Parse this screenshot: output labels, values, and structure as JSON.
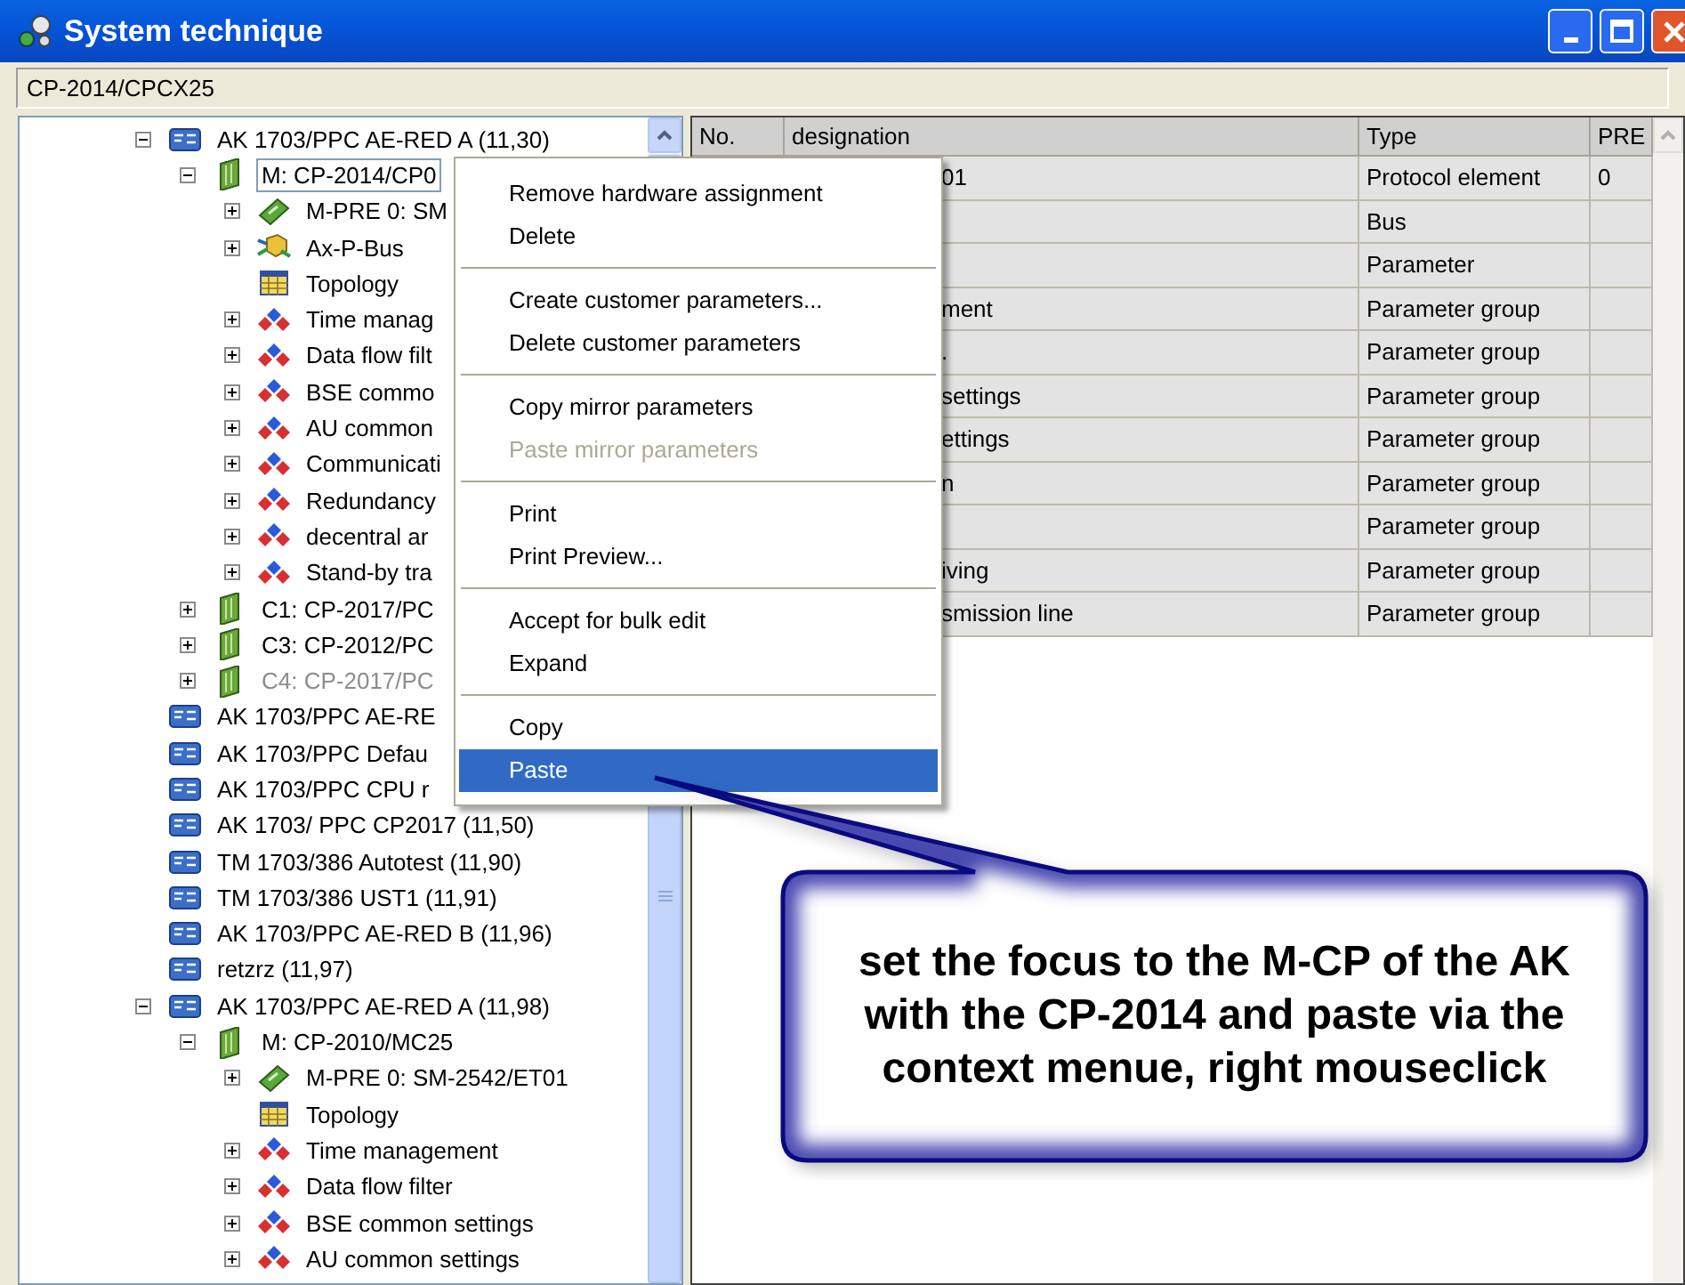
{
  "window": {
    "title": "System technique"
  },
  "path": "CP-2014/CPCX25",
  "tree": [
    {
      "label": "AK 1703/PPC AE-RED A (11,30)",
      "kind": "station",
      "expanded": true,
      "focused": false,
      "disabled": false,
      "children": [
        {
          "label": "M: CP-2014/CP0",
          "kind": "cpu",
          "expanded": true,
          "focused": true,
          "disabled": false,
          "children": [
            {
              "label": "M-PRE 0: SM",
              "kind": "chip",
              "expanded": false,
              "focused": false,
              "disabled": false
            },
            {
              "label": "Ax-P-Bus",
              "kind": "bus",
              "expanded": false,
              "focused": false,
              "disabled": false
            },
            {
              "label": "Topology",
              "kind": "topology",
              "focused": false,
              "disabled": false
            },
            {
              "label": "Time manag",
              "kind": "params",
              "expanded": false,
              "focused": false,
              "disabled": false
            },
            {
              "label": "Data flow filt",
              "kind": "params",
              "expanded": false,
              "focused": false,
              "disabled": false
            },
            {
              "label": "BSE commo",
              "kind": "params",
              "expanded": false,
              "focused": false,
              "disabled": false
            },
            {
              "label": "AU common",
              "kind": "params",
              "expanded": false,
              "focused": false,
              "disabled": false
            },
            {
              "label": "Communicati",
              "kind": "params",
              "expanded": false,
              "focused": false,
              "disabled": false
            },
            {
              "label": "Redundancy",
              "kind": "params",
              "expanded": false,
              "focused": false,
              "disabled": false
            },
            {
              "label": "decentral ar",
              "kind": "params",
              "expanded": false,
              "focused": false,
              "disabled": false
            },
            {
              "label": "Stand-by tra",
              "kind": "params",
              "expanded": false,
              "focused": false,
              "disabled": false
            }
          ]
        },
        {
          "label": "C1: CP-2017/PC",
          "kind": "cpu",
          "expanded": false,
          "focused": false,
          "disabled": false
        },
        {
          "label": "C3: CP-2012/PC",
          "kind": "cpu",
          "expanded": false,
          "focused": false,
          "disabled": false
        },
        {
          "label": "C4: CP-2017/PC",
          "kind": "cpu",
          "expanded": false,
          "focused": false,
          "disabled": true
        }
      ]
    },
    {
      "label": "AK 1703/PPC AE-RE",
      "kind": "station",
      "focused": false,
      "disabled": false
    },
    {
      "label": "AK 1703/PPC Defau",
      "kind": "station",
      "focused": false,
      "disabled": false
    },
    {
      "label": "AK 1703/PPC CPU r",
      "kind": "station",
      "focused": false,
      "disabled": false
    },
    {
      "label": "AK 1703/ PPC CP2017 (11,50)",
      "kind": "station",
      "focused": false,
      "disabled": false
    },
    {
      "label": "TM 1703/386 Autotest (11,90)",
      "kind": "station",
      "focused": false,
      "disabled": false
    },
    {
      "label": "TM 1703/386 UST1 (11,91)",
      "kind": "station",
      "focused": false,
      "disabled": false
    },
    {
      "label": "AK 1703/PPC AE-RED B (11,96)",
      "kind": "station",
      "focused": false,
      "disabled": false
    },
    {
      "label": "retzrz (11,97)",
      "kind": "station",
      "focused": false,
      "disabled": false
    },
    {
      "label": "AK 1703/PPC AE-RED A (11,98)",
      "kind": "station",
      "expanded": true,
      "focused": false,
      "disabled": false,
      "children": [
        {
          "label": "M: CP-2010/MC25",
          "kind": "cpu",
          "expanded": true,
          "focused": false,
          "disabled": false,
          "children": [
            {
              "label": "M-PRE 0: SM-2542/ET01",
              "kind": "chip",
              "expanded": false,
              "focused": false,
              "disabled": false
            },
            {
              "label": "Topology",
              "kind": "topology",
              "focused": false,
              "disabled": false
            },
            {
              "label": "Time management",
              "kind": "params",
              "expanded": false,
              "focused": false,
              "disabled": false
            },
            {
              "label": "Data flow filter",
              "kind": "params",
              "expanded": false,
              "focused": false,
              "disabled": false
            },
            {
              "label": "BSE common settings",
              "kind": "params",
              "expanded": false,
              "focused": false,
              "disabled": false
            },
            {
              "label": "AU common settings",
              "kind": "params",
              "expanded": false,
              "focused": false,
              "disabled": false
            }
          ]
        }
      ]
    }
  ],
  "table": {
    "columns": [
      "No.",
      "designation",
      "Type",
      "PRE"
    ],
    "rows": [
      {
        "designation": "01",
        "type": "Protocol element",
        "pre": "0"
      },
      {
        "type": "Bus"
      },
      {
        "type": "Parameter"
      },
      {
        "designation": "ment",
        "type": "Parameter group"
      },
      {
        "designation": ".",
        "type": "Parameter group"
      },
      {
        "designation": "settings",
        "type": "Parameter group"
      },
      {
        "designation": "ettings",
        "type": "Parameter group"
      },
      {
        "designation": "n",
        "type": "Parameter group"
      },
      {
        "type": "Parameter group"
      },
      {
        "designation": "iving",
        "type": "Parameter group"
      },
      {
        "designation": "smission line",
        "type": "Parameter group"
      }
    ]
  },
  "context_menu": [
    [
      {
        "label": "Remove hardware assignment",
        "disabled": false,
        "selected": false
      },
      {
        "label": "Delete",
        "disabled": false,
        "selected": false
      }
    ],
    [
      {
        "label": "Create customer parameters...",
        "disabled": false,
        "selected": false
      },
      {
        "label": "Delete customer parameters",
        "disabled": false,
        "selected": false
      }
    ],
    [
      {
        "label": "Copy mirror parameters",
        "disabled": false,
        "selected": false
      },
      {
        "label": "Paste mirror parameters",
        "disabled": true,
        "selected": false
      }
    ],
    [
      {
        "label": "Print",
        "disabled": false,
        "selected": false
      },
      {
        "label": "Print Preview...",
        "disabled": false,
        "selected": false
      }
    ],
    [
      {
        "label": "Accept for bulk edit",
        "disabled": false,
        "selected": false
      },
      {
        "label": "Expand",
        "disabled": false,
        "selected": false
      }
    ],
    [
      {
        "label": "Copy",
        "disabled": false,
        "selected": false
      },
      {
        "label": "Paste",
        "disabled": false,
        "selected": true
      }
    ]
  ],
  "callout": "set the focus to the M-CP of the AK with the CP-2014 and paste via the context menue, right mouseclick"
}
